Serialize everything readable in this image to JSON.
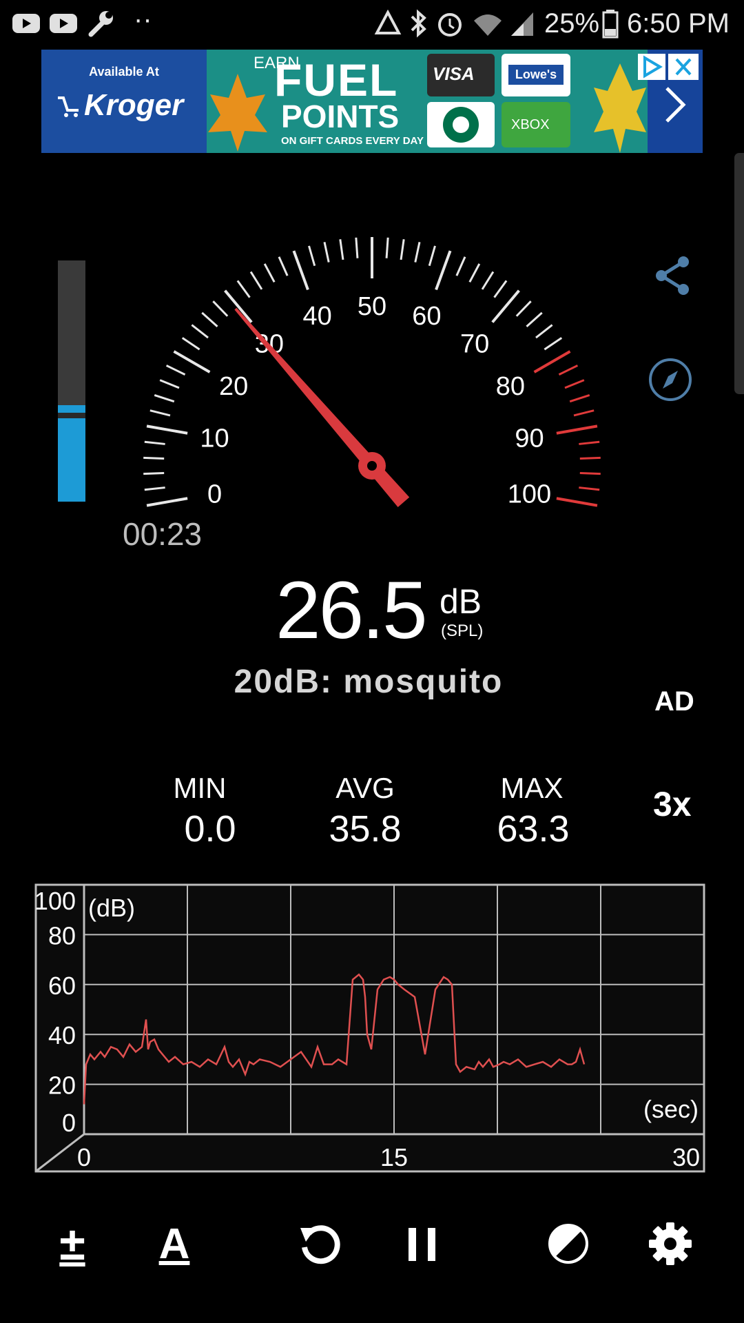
{
  "status_bar": {
    "battery": "25%",
    "time": "6:50 PM",
    "dots": "··"
  },
  "ad_banner": {
    "available_at": "Available At",
    "store": "Kroger",
    "earn": "EARN",
    "headline_1": "FUEL",
    "headline_2": "POINTS",
    "subline": "ON GIFT CARDS EVERY DAY",
    "card_visa": "VISA",
    "card_lowes": "Lowe's",
    "card_xbox": "XBOX"
  },
  "gauge": {
    "labels": [
      "0",
      "10",
      "20",
      "30",
      "40",
      "50",
      "60",
      "70",
      "80",
      "90",
      "100"
    ],
    "min": 0,
    "max": 100,
    "red_zone_start": 80,
    "needle_value": 29.5,
    "colors": {
      "ticks": "#e8e8e8",
      "red": "#e03a3a",
      "needle": "#d93a3e"
    }
  },
  "level": {
    "fill_fraction": 0.4,
    "peak_fraction": 0.345
  },
  "timer": "00:23",
  "reading": {
    "value": "26.5",
    "unit": "dB",
    "unit_sub": "(SPL)"
  },
  "reference": "20dB: mosquito",
  "side_buttons": {
    "ad": "AD",
    "zoom": "3x"
  },
  "stats": {
    "min_label": "MIN",
    "min_value": "0.0",
    "avg_label": "AVG",
    "avg_value": "35.8",
    "max_label": "MAX",
    "max_value": "63.3"
  },
  "chart_data": {
    "type": "line",
    "ylabel": "(dB)",
    "xlabel": "(sec)",
    "y_ticks": [
      "100",
      "80",
      "60",
      "40",
      "20",
      "0"
    ],
    "x_ticks": [
      "0",
      "15",
      "30"
    ],
    "xlim": [
      0,
      30
    ],
    "ylim": [
      0,
      100
    ],
    "grid": true,
    "series_color": "#e05050",
    "x": [
      0,
      0.1,
      0.3,
      0.5,
      0.8,
      1.0,
      1.3,
      1.6,
      1.9,
      2.2,
      2.5,
      2.8,
      3.0,
      3.1,
      3.2,
      3.4,
      3.6,
      3.8,
      4.1,
      4.4,
      4.8,
      5.2,
      5.6,
      6.0,
      6.4,
      6.8,
      7.0,
      7.2,
      7.5,
      7.8,
      8.0,
      8.2,
      8.5,
      9.0,
      9.5,
      10.0,
      10.5,
      11.0,
      11.3,
      11.6,
      12.0,
      12.3,
      12.5,
      12.7,
      13.0,
      13.3,
      13.5,
      13.6,
      13.7,
      13.9,
      14.2,
      14.5,
      14.8,
      15.0,
      15.2,
      15.5,
      16.0,
      16.5,
      17.0,
      17.4,
      17.6,
      17.8,
      18.0,
      18.2,
      18.5,
      18.9,
      19.1,
      19.3,
      19.6,
      19.8,
      20.1,
      20.3,
      20.6,
      21.0,
      21.4,
      21.8,
      22.2,
      22.6,
      23.0,
      23.4,
      23.6,
      23.8,
      24.0,
      24.2
    ],
    "y": [
      12,
      28,
      32,
      30,
      33,
      31,
      35,
      34,
      31,
      36,
      33,
      35,
      46,
      34,
      37,
      38,
      34,
      32,
      29,
      31,
      28,
      29,
      27,
      30,
      28,
      35,
      29,
      27,
      30,
      24,
      29,
      28,
      30,
      29,
      27,
      30,
      33,
      27,
      35,
      28,
      28,
      30,
      29,
      28,
      62,
      64,
      62,
      55,
      40,
      34,
      58,
      62,
      63,
      62,
      60,
      58,
      55,
      32,
      58,
      63,
      62,
      60,
      28,
      25,
      27,
      26,
      29,
      27,
      30,
      27,
      28,
      29,
      28,
      30,
      27,
      28,
      29,
      27,
      30,
      28,
      28,
      29,
      34,
      28
    ]
  },
  "toolbar": {
    "calibrate": "±",
    "weighting": "A"
  }
}
